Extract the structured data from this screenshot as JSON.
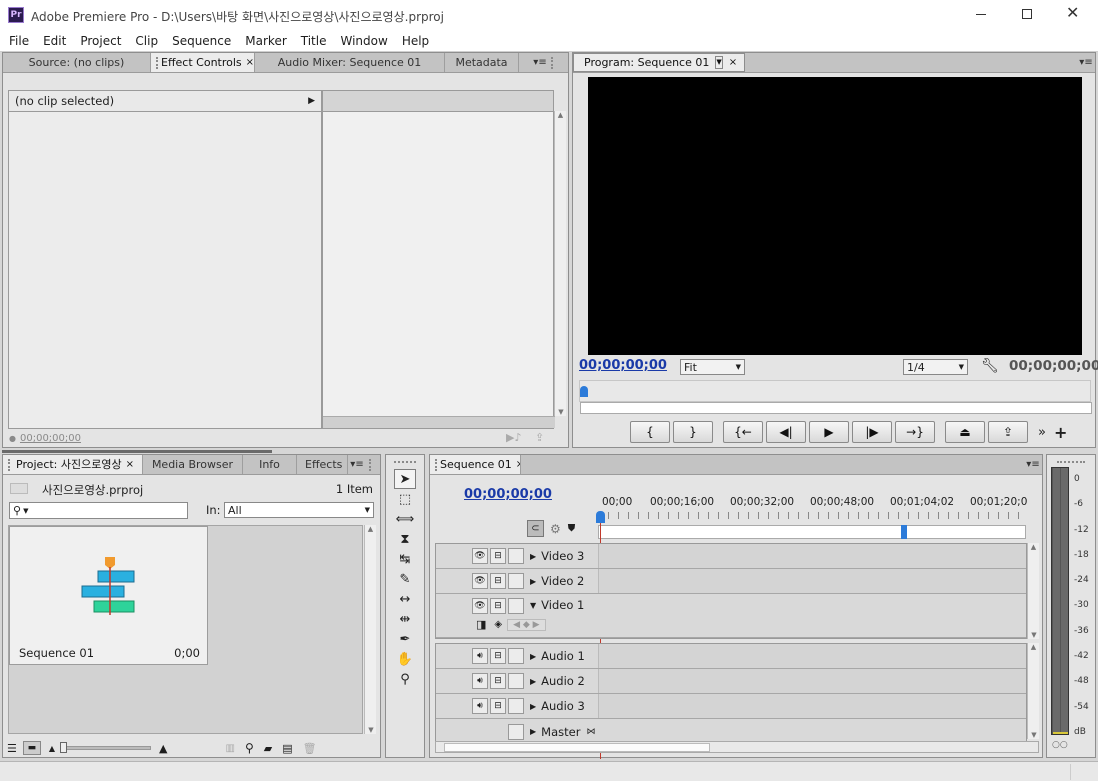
{
  "app": {
    "title": "Adobe Premiere Pro - D:\\Users\\바탕 화면\\사진으로영상\\사진으로영상.prproj",
    "logo": "Pr",
    "window_controls": [
      "minimize",
      "maximize",
      "close"
    ]
  },
  "menu": [
    "File",
    "Edit",
    "Project",
    "Clip",
    "Sequence",
    "Marker",
    "Title",
    "Window",
    "Help"
  ],
  "source_panel": {
    "tabs": [
      "Source: (no clips)",
      "Effect Controls",
      "Audio Mixer: Sequence 01",
      "Metadata"
    ],
    "active": "Effect Controls",
    "clip_header": "(no clip selected)",
    "timecode": "00;00;00;00"
  },
  "program": {
    "tab": "Program: Sequence 01",
    "timecode_left": "00;00;00;00",
    "zoom": "Fit",
    "resolution": "1/4",
    "timecode_right": "00;00;00;00",
    "transport": [
      "{",
      "}",
      "{←",
      "◀|",
      "▶",
      "|▶",
      "→}"
    ],
    "extra": [
      "lift",
      "extract"
    ],
    "more": "»",
    "add": "+"
  },
  "project": {
    "tabs": [
      "Project: 사진으로영상",
      "Media Browser",
      "Info",
      "Effects"
    ],
    "file": "사진으로영상.prproj",
    "count": "1 Item",
    "search_placeholder": "",
    "in_label": "In:",
    "in_value": "All",
    "item_name": "Sequence 01",
    "item_duration": "0;00"
  },
  "timeline": {
    "tab": "Sequence 01",
    "timecode": "00;00;00;00",
    "ruler": [
      "00;00",
      "00;00;16;00",
      "00;00;32;00",
      "00;00;48;00",
      "00;01;04;02",
      "00;01;20;0"
    ],
    "video_tracks": [
      "Video 3",
      "Video 2",
      "Video 1"
    ],
    "audio_tracks": [
      "Audio 1",
      "Audio 2",
      "Audio 3"
    ],
    "master": "Master"
  },
  "meter": {
    "labels": [
      "0",
      "-6",
      "-12",
      "-18",
      "-24",
      "-30",
      "-36",
      "-42",
      "-48",
      "-54",
      "dB"
    ]
  },
  "colors": {
    "accent": "#1a3aa8",
    "playhead": "#c0392b",
    "clip_blue": "#2ab0e0",
    "clip_green": "#2ed39a",
    "marker_orange": "#f19a2e"
  }
}
